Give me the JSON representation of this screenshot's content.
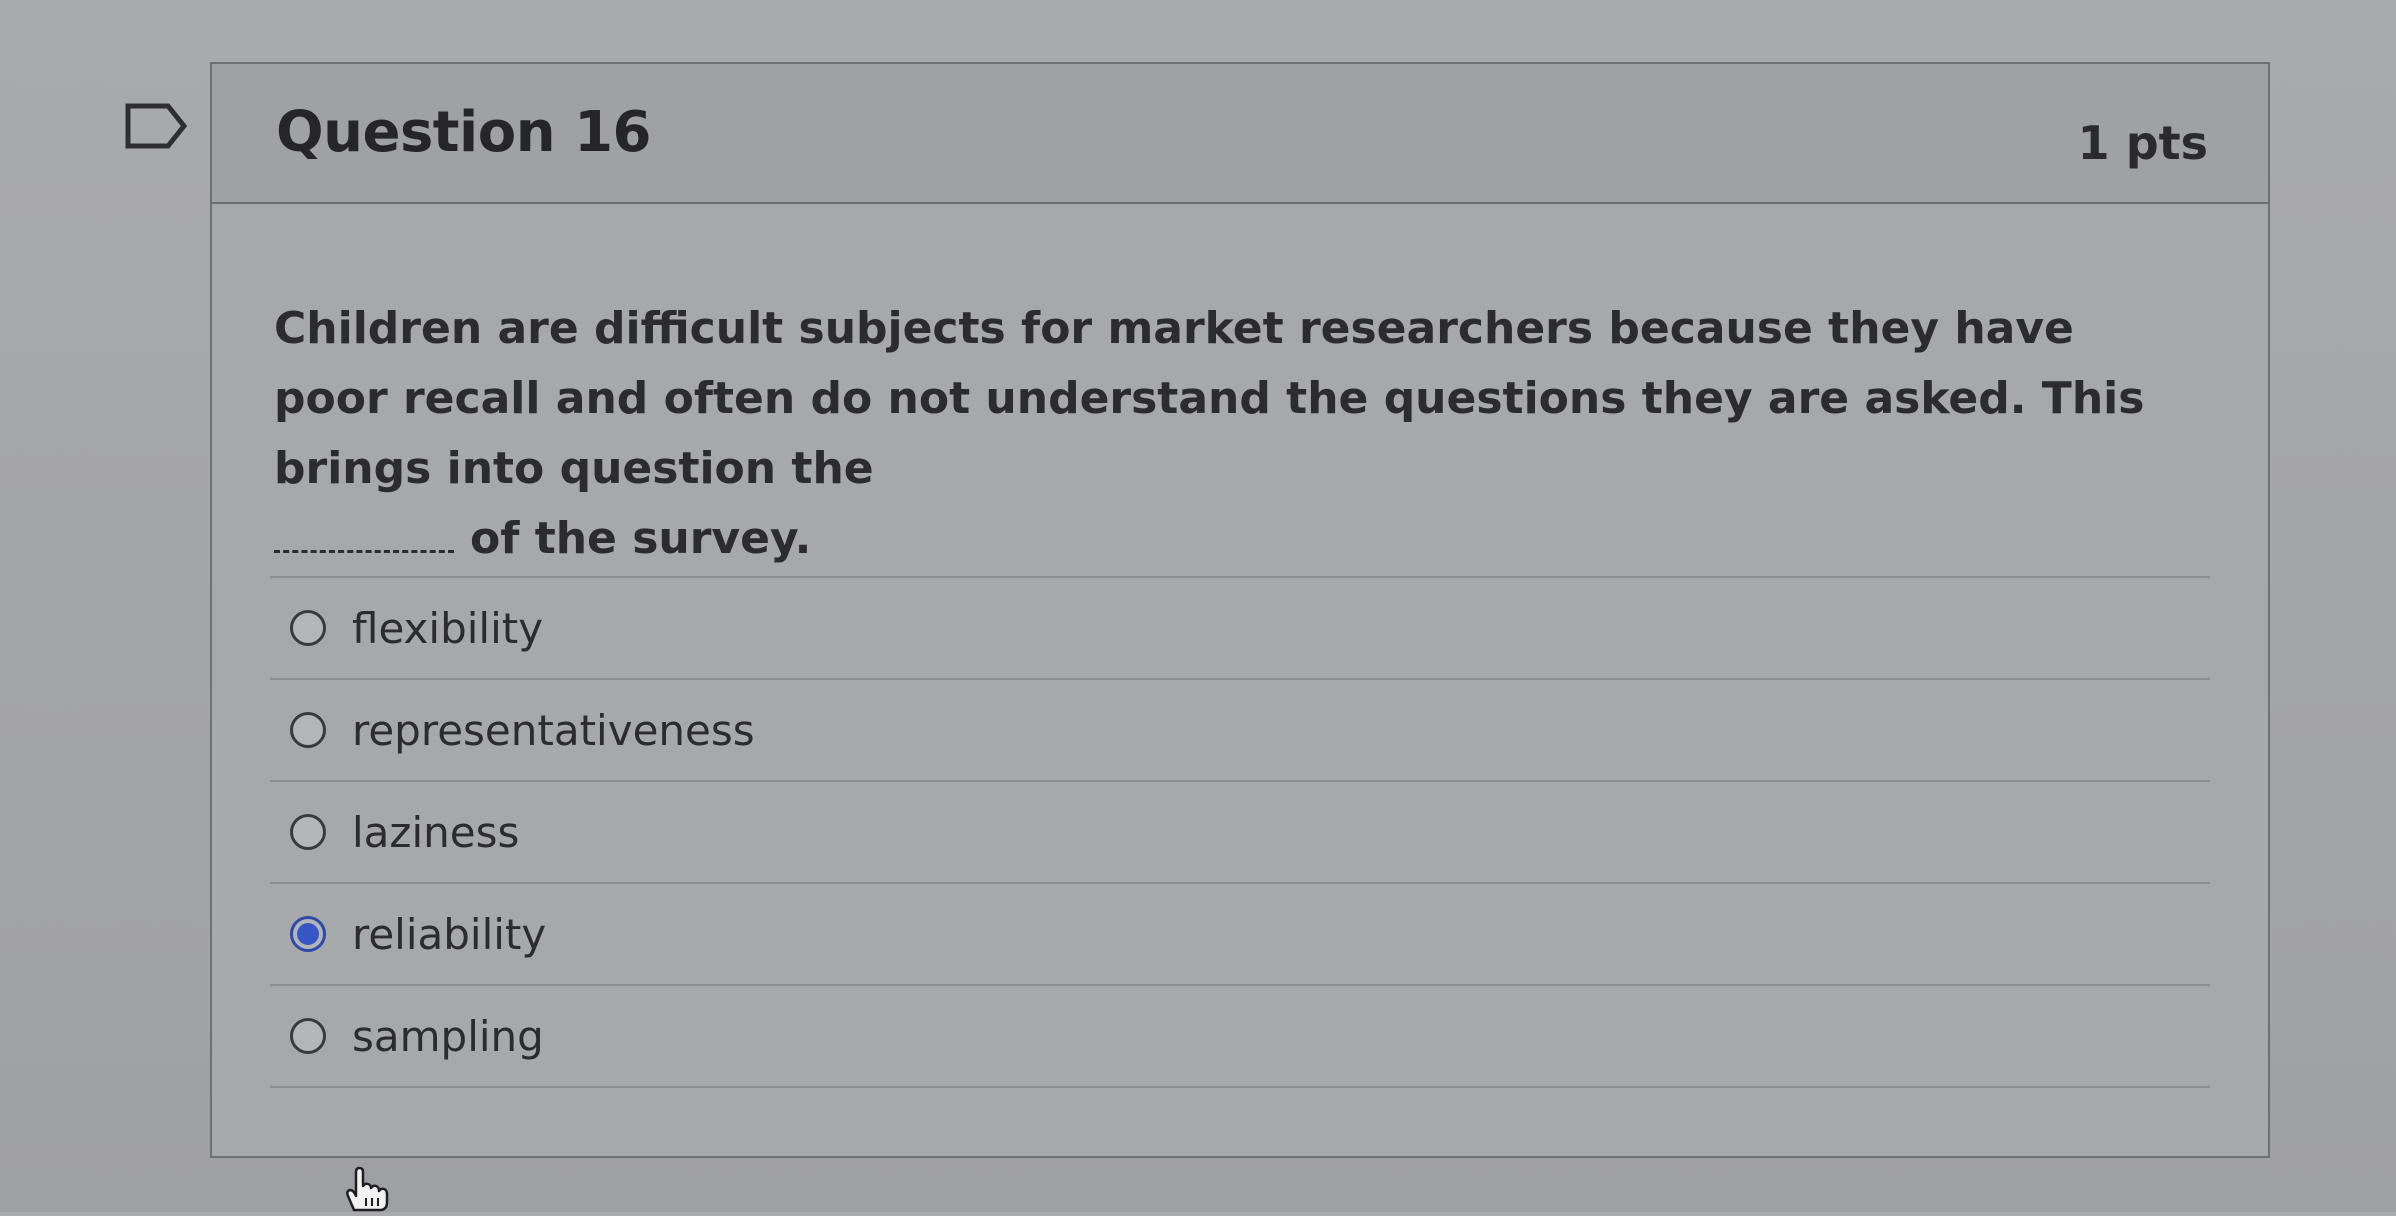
{
  "question": {
    "title": "Question 16",
    "points": "1 pts",
    "text_before_blank": "Children are difficult subjects for market researchers because they have poor recall and often do not understand the questions they are asked. This brings into question the",
    "blank": "________",
    "text_after_blank": "of the survey."
  },
  "answers": [
    {
      "label": "flexibility",
      "selected": false
    },
    {
      "label": "representativeness",
      "selected": false
    },
    {
      "label": "laziness",
      "selected": false
    },
    {
      "label": "reliability",
      "selected": true
    },
    {
      "label": "sampling",
      "selected": false
    }
  ],
  "colors": {
    "selected_radio": "#3556c4",
    "card_background": "#a7a8ac"
  },
  "icons": {
    "flag": "flag-outline-icon",
    "cursor": "hand-pointer-icon"
  }
}
